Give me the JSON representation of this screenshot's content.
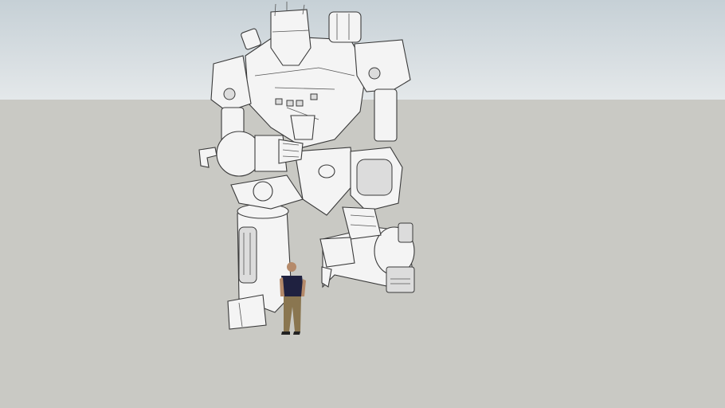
{
  "scene": {
    "colors": {
      "sky_top": "#c6d0d6",
      "sky_horizon": "#e4e8ea",
      "ground": "#c9c9c4",
      "model_fill": "#f4f4f4",
      "edge": "#3a3a3a",
      "figure_shirt": "#1f2140",
      "figure_pants": "#8a7650"
    },
    "objects": [
      "robot-model",
      "scale-figure"
    ]
  }
}
